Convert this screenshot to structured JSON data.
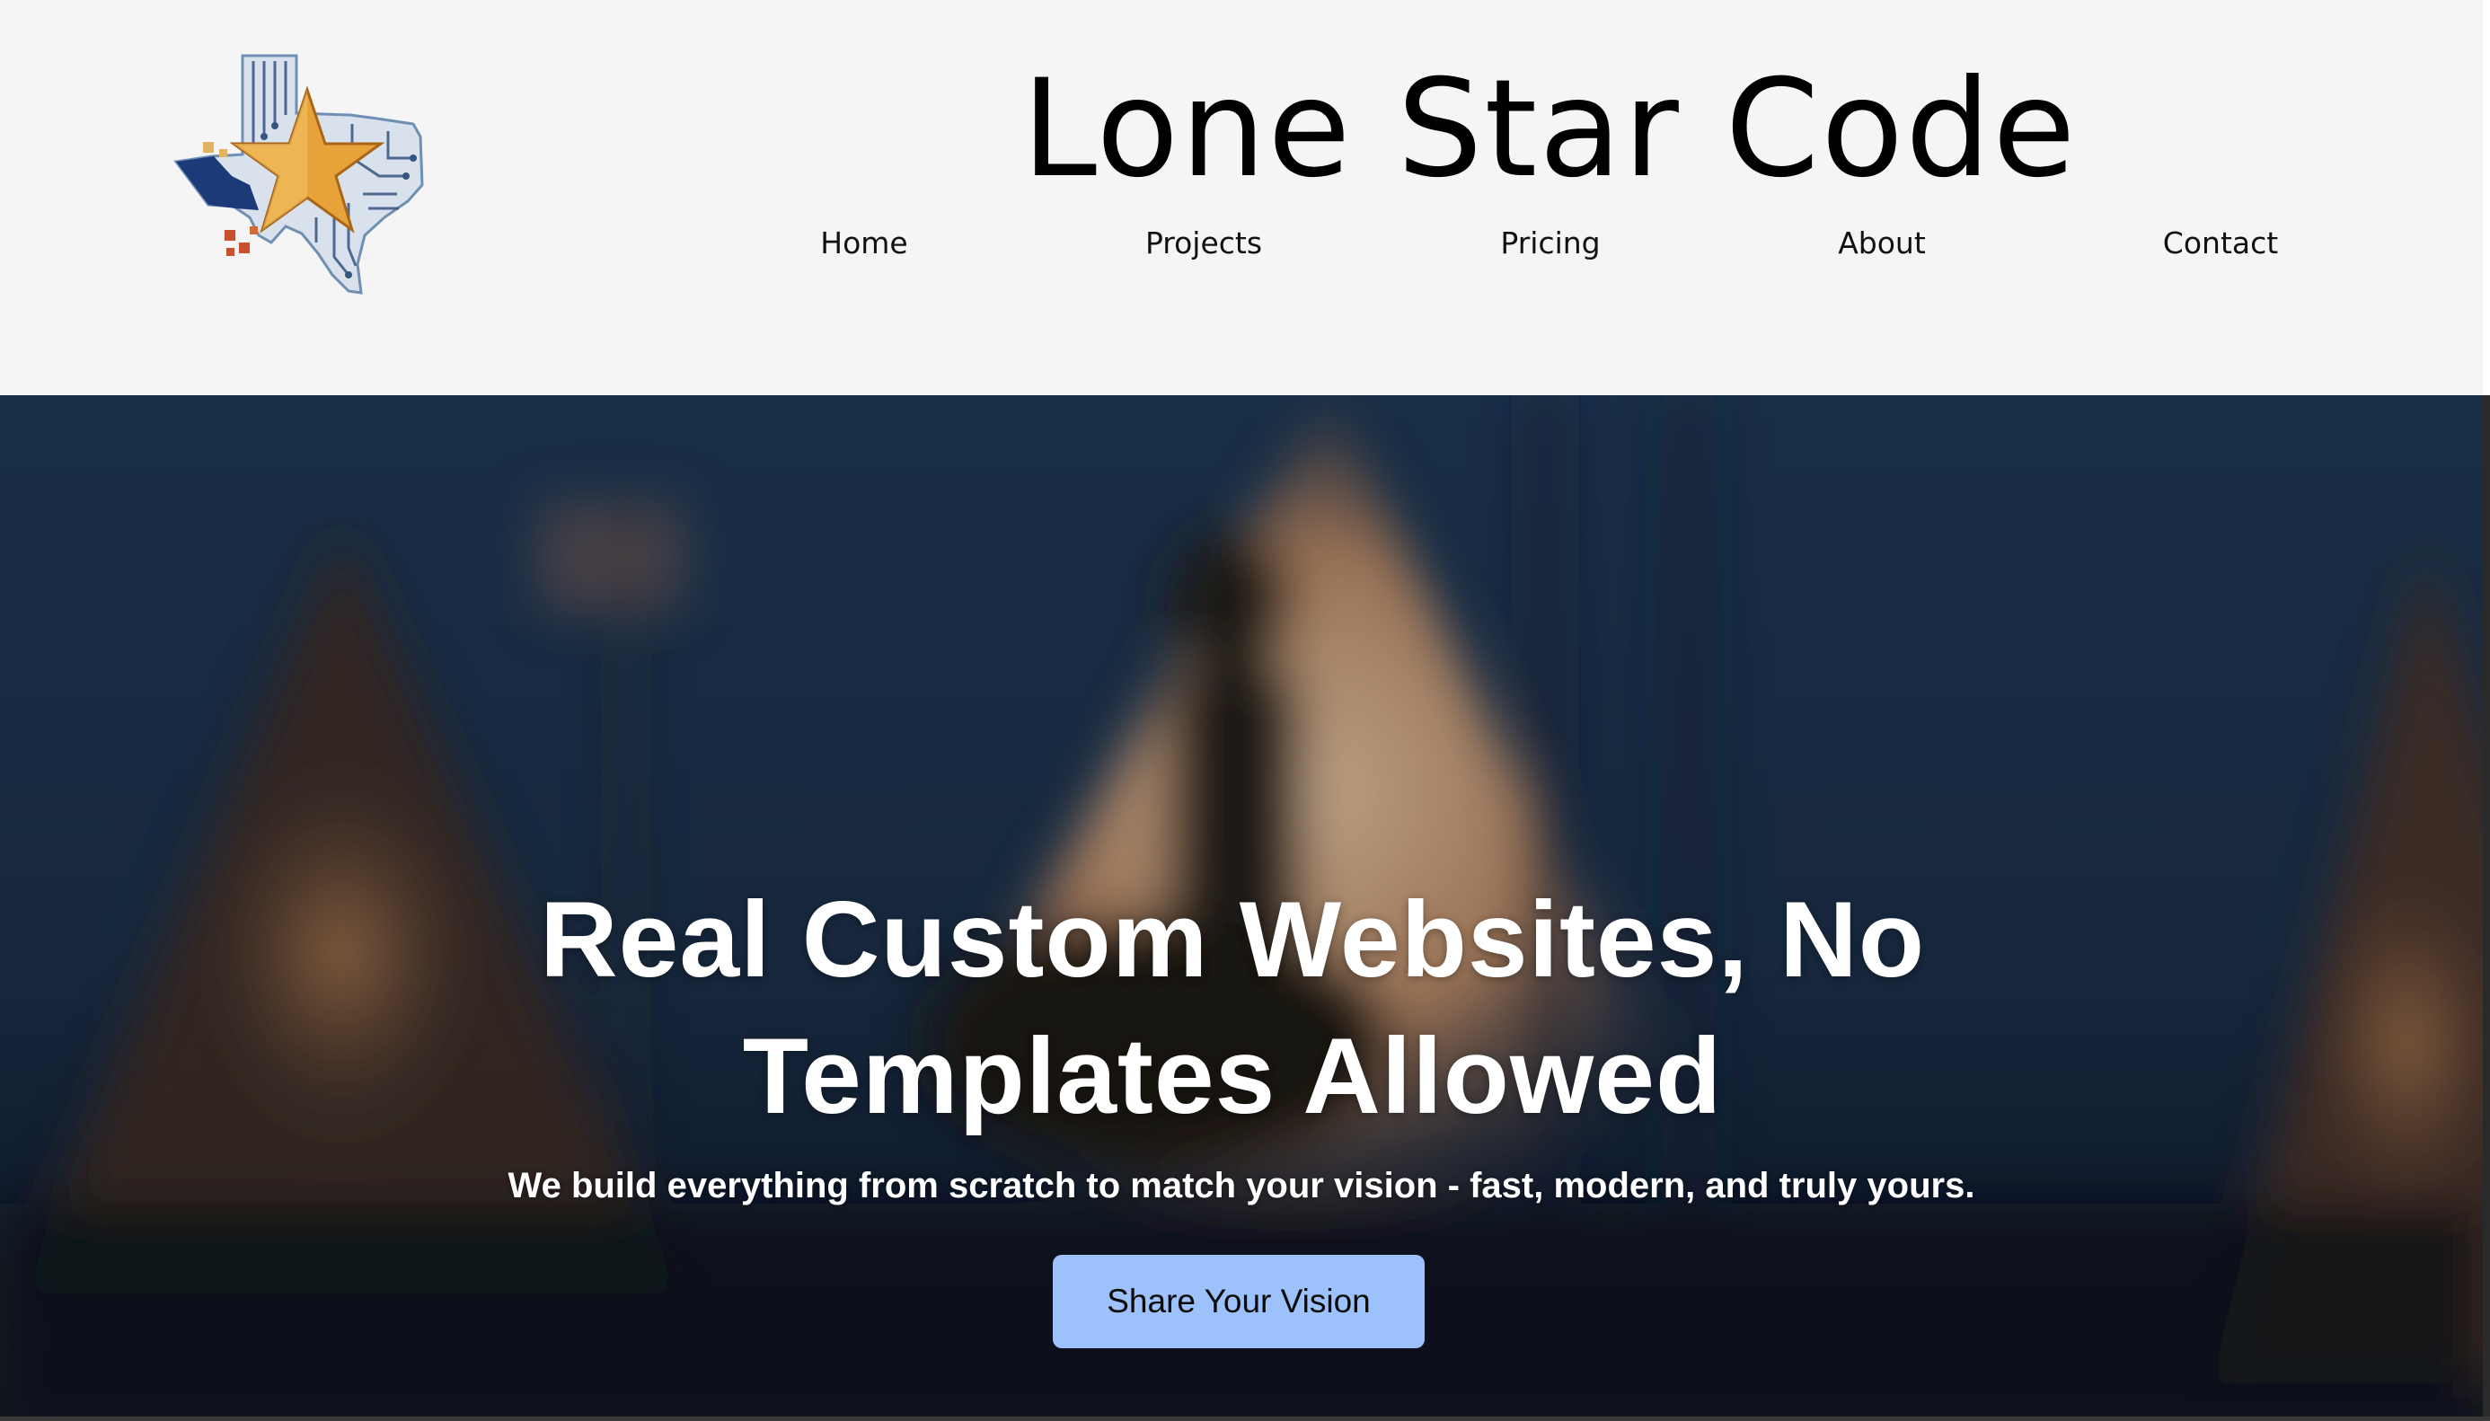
{
  "header": {
    "site_title": "Lone Star Code",
    "logo_icon": "texas-star-circuit-logo",
    "nav": [
      {
        "label": "Home"
      },
      {
        "label": "Projects"
      },
      {
        "label": "Pricing"
      },
      {
        "label": "About"
      },
      {
        "label": "Contact"
      }
    ]
  },
  "hero": {
    "headline_line1": "Real Custom Websites, No",
    "headline_line2": "Templates Allowed",
    "subheadline": "We build everything from scratch to match your vision - fast, modern, and truly yours.",
    "cta_label": "Share Your Vision",
    "background": "blurred-tipi-village-night-photo"
  },
  "colors": {
    "header_bg": "#f5f5f5",
    "cta_bg": "#9cc1fb",
    "hero_text": "#ffffff",
    "hero_overlay": "#1b2a3c",
    "logo_star": "#e8a23a",
    "logo_navy": "#1c3a78"
  }
}
